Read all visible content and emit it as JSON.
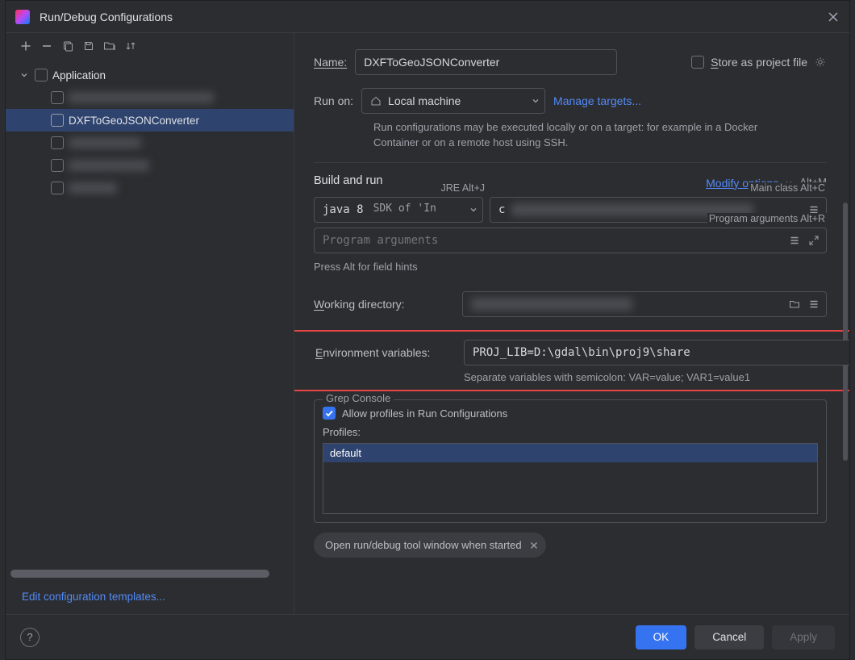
{
  "title": "Run/Debug Configurations",
  "tree": {
    "root_label": "Application",
    "selected_label": "DXFToGeoJSONConverter"
  },
  "edit_templates_link": "Edit configuration templates...",
  "name": {
    "label": "Name:",
    "value": "DXFToGeoJSONConverter"
  },
  "store_project": "Store as project file",
  "run_on": {
    "label": "Run on:",
    "value": "Local machine",
    "manage": "Manage targets...",
    "hint": "Run configurations may be executed locally or on a target: for example in a Docker Container or on a remote host using SSH."
  },
  "build_run": {
    "title": "Build and run",
    "modify": "Modify options",
    "modify_shortcut": "Alt+M",
    "jre_hint": "JRE Alt+J",
    "main_class_hint": "Main class Alt+C",
    "program_args_hint": "Program arguments Alt+R",
    "jre_value": "java 8",
    "jre_sub": "SDK of 'In",
    "main_class_prefix": "c",
    "program_args_placeholder": "Program arguments",
    "press_hint": "Press Alt for field hints"
  },
  "working_dir": {
    "label": "Working directory:"
  },
  "env": {
    "label": "Environment variables:",
    "value": "PROJ_LIB=D:\\gdal\\bin\\proj9\\share",
    "hint": "Separate variables with semicolon: VAR=value; VAR1=value1"
  },
  "grep": {
    "legend": "Grep Console",
    "checkbox_label": "Allow profiles in Run Configurations",
    "profiles_label": "Profiles:",
    "selected_profile": "default"
  },
  "chip": "Open run/debug tool window when started",
  "buttons": {
    "ok": "OK",
    "cancel": "Cancel",
    "apply": "Apply"
  }
}
